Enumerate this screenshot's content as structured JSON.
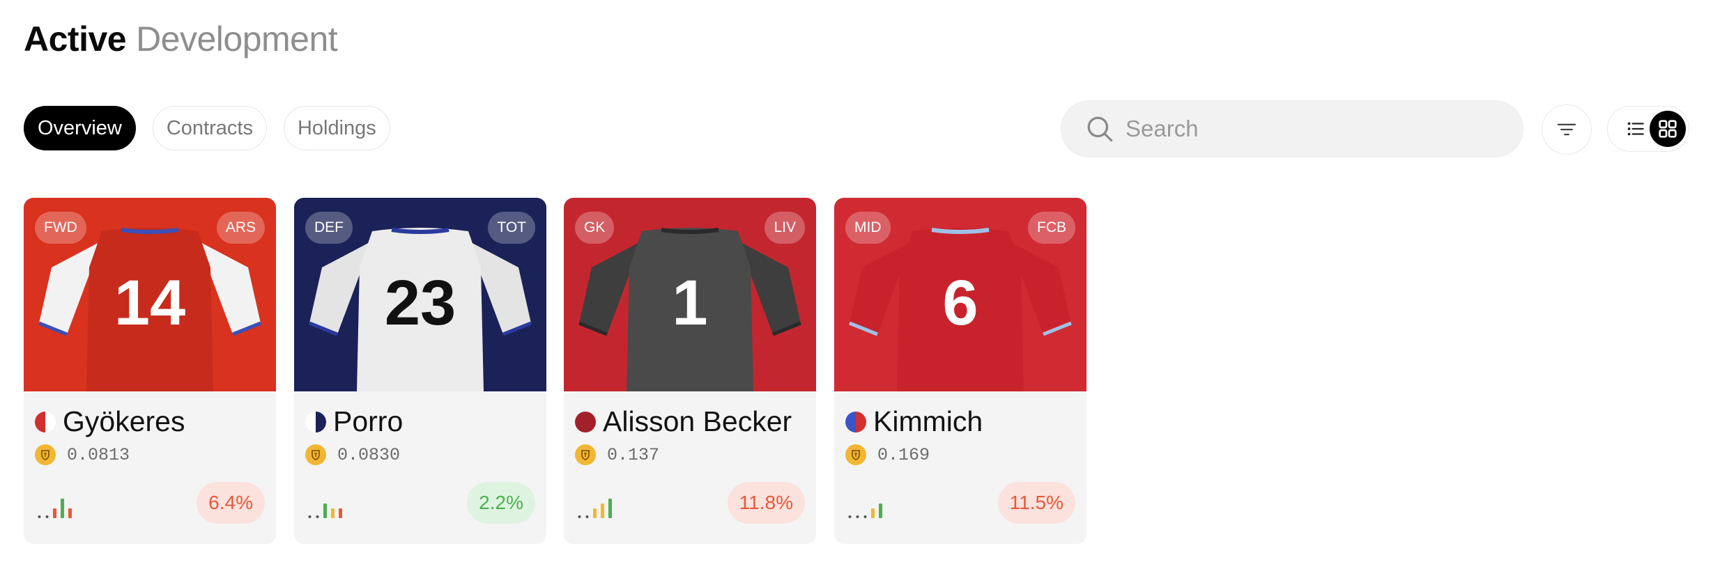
{
  "header": {
    "title_primary": "Active",
    "title_secondary": "Development"
  },
  "tabs": [
    {
      "label": "Overview",
      "active": true
    },
    {
      "label": "Contracts",
      "active": false
    },
    {
      "label": "Holdings",
      "active": false
    }
  ],
  "search": {
    "placeholder": "Search",
    "value": ""
  },
  "toolbar": {
    "filter_icon": "filter-icon",
    "list_view_icon": "list-view-icon",
    "grid_view_icon": "grid-view-icon",
    "active_view": "grid"
  },
  "cards": [
    {
      "position": "FWD",
      "team": "ARS",
      "name": "Gyökeres",
      "price": "0.0813",
      "change": "6.4%",
      "trend": "negative",
      "shirt_number": "14",
      "colors": {
        "background": "#d9321f",
        "shirt": "#c72b1c",
        "sleeves": "#f2f2f2",
        "number": "#ffffff",
        "trim": "#3b4fb8"
      },
      "flag_colors": [
        "#d32f2f",
        "#ffffff"
      ],
      "activity_levels": [
        1,
        1,
        2,
        4,
        2
      ],
      "activity_colors": [
        "#555555",
        "#555555",
        "#e8583c",
        "#4caf50",
        "#e8583c"
      ]
    },
    {
      "position": "DEF",
      "team": "TOT",
      "name": "Porro",
      "price": "0.0830",
      "change": "2.2%",
      "trend": "positive",
      "shirt_number": "23",
      "colors": {
        "background": "#1b2257",
        "shirt": "#ececec",
        "sleeves": "#e4e4e4",
        "number": "#111111",
        "trim": "#2a3a9e"
      },
      "flag_colors": [
        "#ffffff",
        "#1b2257"
      ],
      "activity_levels": [
        1,
        1,
        3,
        2,
        2
      ],
      "activity_colors": [
        "#555555",
        "#555555",
        "#4caf50",
        "#f2b632",
        "#e8583c"
      ]
    },
    {
      "position": "GK",
      "team": "LIV",
      "name": "Alisson Becker",
      "price": "0.137",
      "change": "11.8%",
      "trend": "negative",
      "shirt_number": "1",
      "colors": {
        "background": "#c4262f",
        "shirt": "#4a4a4a",
        "sleeves": "#3e3e3e",
        "number": "#ffffff",
        "trim": "#2a2a2a"
      },
      "flag_colors": [
        "#a3202a",
        "#a3202a"
      ],
      "activity_levels": [
        1,
        1,
        2,
        3,
        4
      ],
      "activity_colors": [
        "#555555",
        "#555555",
        "#f2b632",
        "#f2b632",
        "#4caf50"
      ]
    },
    {
      "position": "MID",
      "team": "FCB",
      "name": "Kimmich",
      "price": "0.169",
      "change": "11.5%",
      "trend": "negative",
      "shirt_number": "6",
      "colors": {
        "background": "#d02b33",
        "shirt": "#c8232c",
        "sleeves": "#c8232c",
        "number": "#ffffff",
        "trim": "#9fc1e8"
      },
      "flag_colors": [
        "#3a56c6",
        "#d32f2f"
      ],
      "activity_levels": [
        1,
        1,
        1,
        2,
        3
      ],
      "activity_colors": [
        "#555555",
        "#555555",
        "#555555",
        "#f2b632",
        "#4caf50"
      ]
    }
  ]
}
